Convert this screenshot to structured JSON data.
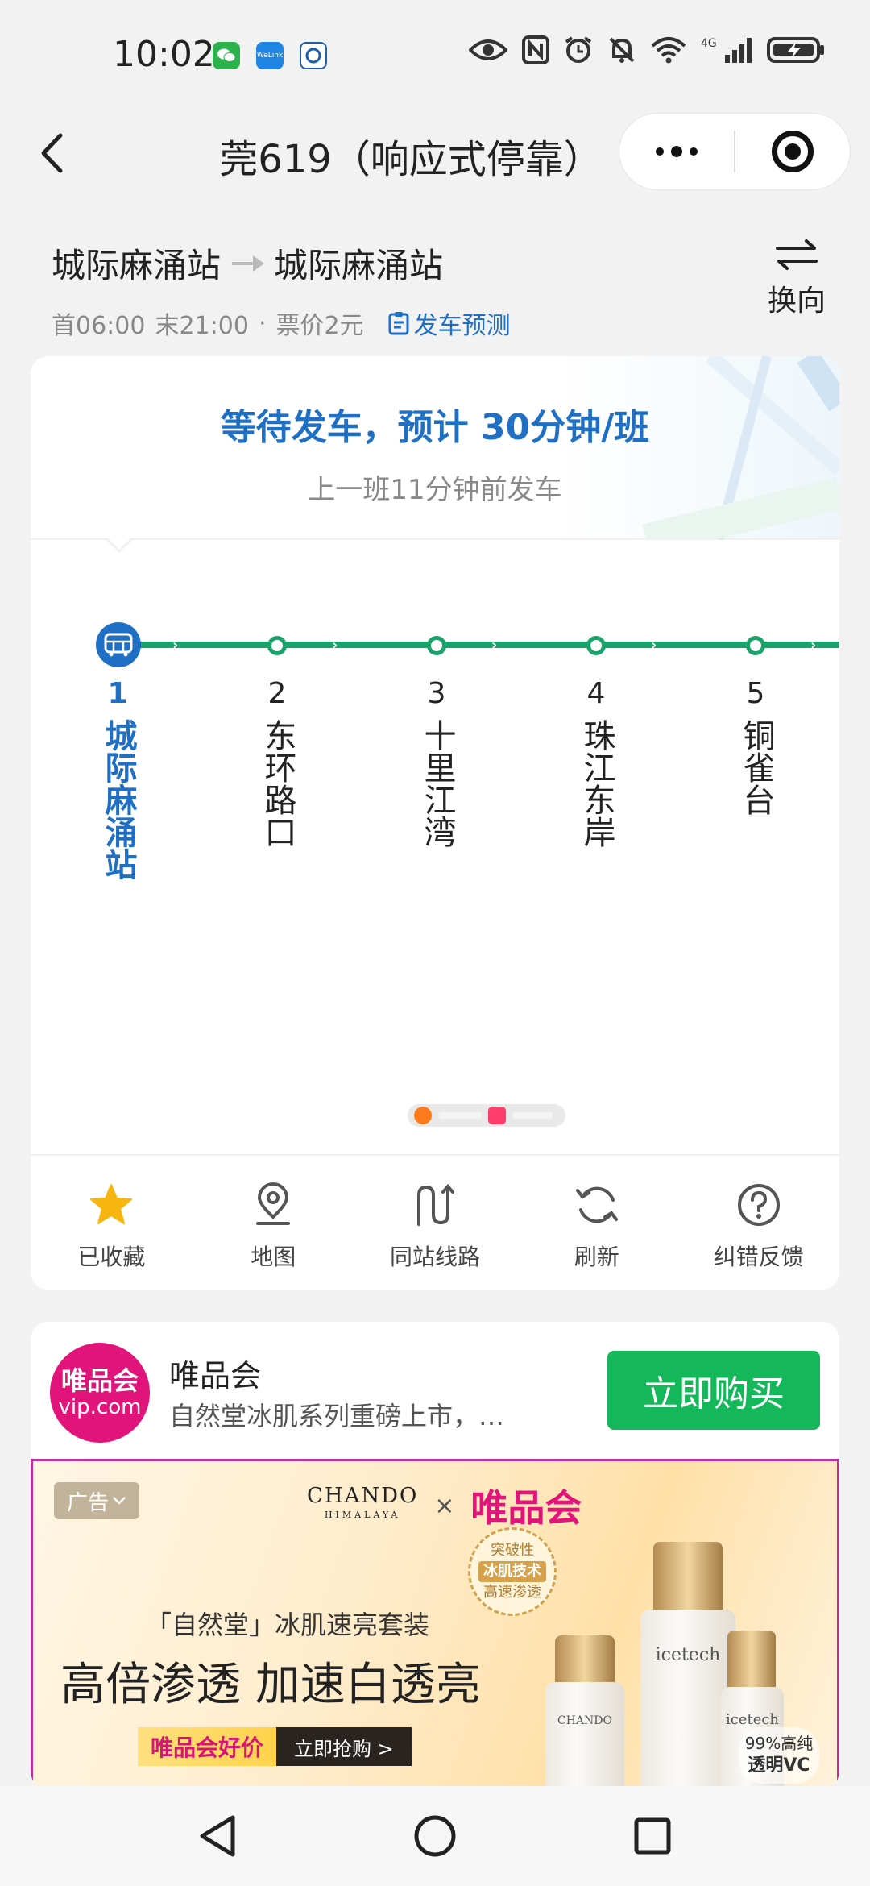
{
  "status_bar": {
    "time": "10:02",
    "notification_icons": [
      "wechat-icon",
      "welink-icon",
      "app-icon"
    ],
    "welink_label": "WeLink",
    "system_icons": [
      "eye-icon",
      "nfc-icon",
      "alarm-icon",
      "mute-icon",
      "wifi-icon",
      "signal-icon",
      "battery-icon"
    ],
    "network": "4G"
  },
  "title_bar": {
    "title": "莞619（响应式停靠）"
  },
  "route": {
    "from": "城际麻涌站",
    "to": "城际麻涌站",
    "first_bus": "首06:00",
    "last_bus": "末21:00",
    "separator": "·",
    "fare": "票价2元",
    "forecast_label": "发车预测",
    "swap_label": "换向"
  },
  "status": {
    "wait_text": "等待发车，预计 30分钟/班",
    "last_departure": "上一班11分钟前发车"
  },
  "stops": [
    {
      "num": "1",
      "name": "城际麻涌站",
      "current": true
    },
    {
      "num": "2",
      "name": "东环路口",
      "current": false
    },
    {
      "num": "3",
      "name": "十里江湾",
      "current": false
    },
    {
      "num": "4",
      "name": "珠江东岸",
      "current": false
    },
    {
      "num": "5",
      "name": "铜雀台",
      "current": false
    }
  ],
  "actions": [
    {
      "label": "已收藏",
      "icon": "star-icon"
    },
    {
      "label": "地图",
      "icon": "map-pin-icon"
    },
    {
      "label": "同站线路",
      "icon": "route-icon"
    },
    {
      "label": "刷新",
      "icon": "refresh-icon"
    },
    {
      "label": "纠错反馈",
      "icon": "help-icon"
    }
  ],
  "ad": {
    "logo_line1": "唯品会",
    "logo_line2": "vip.com",
    "name": "唯品会",
    "description": "自然堂冰肌系列重磅上市，…",
    "buy_label": "立即购买",
    "tag": "广告",
    "brand1": "CHANDO",
    "brand1_sub": "HIMALAYA",
    "brand_x": "×",
    "brand2": "唯品会",
    "seal_top": "突破性",
    "seal_mid": "冰肌技术",
    "seal_bottom": "高速渗透",
    "line1": "「自然堂」冰肌速亮套装",
    "line2": "高倍渗透 加速白透亮",
    "cta_left": "唯品会好价",
    "cta_right": "立即抢购 >",
    "bottle_label": "icetech",
    "bottle_sub": "CHANDO",
    "vc_line1": "99%高纯",
    "vc_line2": "透明VC"
  },
  "colors": {
    "accent_blue": "#1f6fc5",
    "line_green": "#1aa26b",
    "buy_green": "#14b85a",
    "vip_pink": "#e0147a"
  }
}
